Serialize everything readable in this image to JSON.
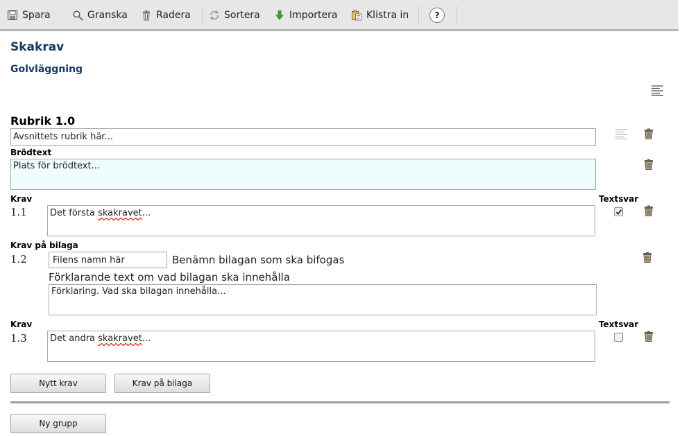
{
  "toolbar": {
    "items": [
      {
        "label": "Spara",
        "icon": "save-icon"
      },
      {
        "label": "Granska",
        "icon": "magnifier-icon"
      },
      {
        "label": "Radera",
        "icon": "trash-icon"
      },
      {
        "label": "Sortera",
        "icon": "sort-icon"
      },
      {
        "label": "Importera",
        "icon": "import-arrow-icon"
      },
      {
        "label": "Klistra in",
        "icon": "paste-icon"
      }
    ],
    "help_label": "?"
  },
  "page": {
    "title": "Skakrav",
    "subtitle": "Golvläggning"
  },
  "section": {
    "heading": "Rubrik 1.0",
    "heading_value": "Avsnittets rubrik här...",
    "body_label": "Brödtext",
    "body_value": "Plats för brödtext..."
  },
  "requirements": [
    {
      "type_label": "Krav",
      "number": "1.1",
      "text_before": "Det första ",
      "text_misspelled": "skakravet",
      "text_after": "...",
      "textsvar_label": "Textsvar",
      "textsvar_checked": true
    },
    {
      "type_label": "Krav på bilaga",
      "number": "1.2",
      "filename_value": "Filens namn här",
      "filename_hint": "Benämn bilagan som ska bifogas",
      "explanation_label": "Förklarande text om vad bilagan ska innehålla",
      "explanation_value": "Förklaring. Vad ska bilagan innehålla..."
    },
    {
      "type_label": "Krav",
      "number": "1.3",
      "text_before": "Det andra ",
      "text_misspelled": "skakravet",
      "text_after": "...",
      "textsvar_label": "Textsvar",
      "textsvar_checked": false
    }
  ],
  "buttons": {
    "new_requirement": "Nytt krav",
    "attachment_requirement": "Krav på bilaga",
    "new_group": "Ny grupp"
  },
  "colors": {
    "heading": "#17385e",
    "toolbar_bg": "#e7e7e7",
    "body_field_bg": "#effdfd",
    "misspelling": "#d22222"
  }
}
